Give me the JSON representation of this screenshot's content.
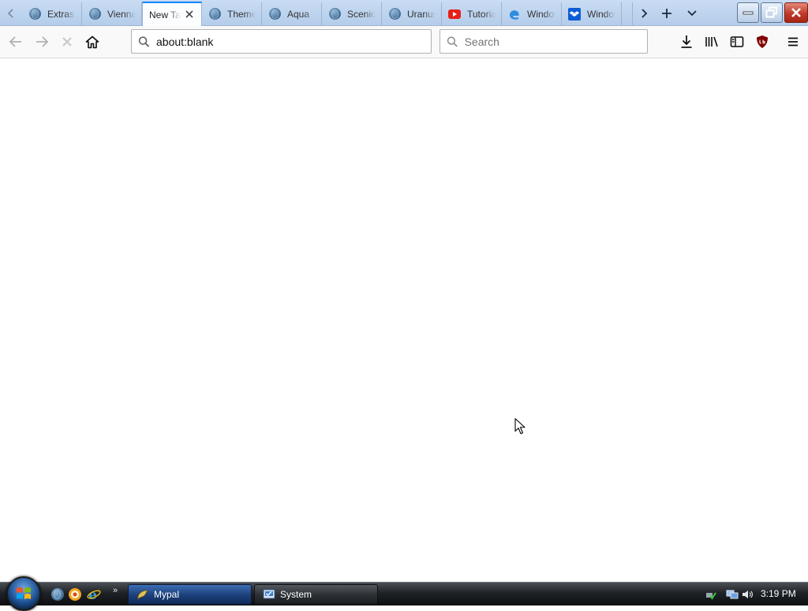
{
  "browser": {
    "tabs": [
      {
        "title": "Extras",
        "icon": "globe-icon",
        "active": false
      },
      {
        "title": "Vienna",
        "icon": "globe-icon",
        "active": false
      },
      {
        "title": "New Tab",
        "icon": "none",
        "active": true
      },
      {
        "title": "Themes",
        "icon": "globe-icon",
        "active": false
      },
      {
        "title": "Aqua",
        "icon": "globe-icon",
        "active": false
      },
      {
        "title": "Scenic",
        "icon": "globe-icon",
        "active": false
      },
      {
        "title": "Uranus",
        "icon": "globe-icon",
        "active": false
      },
      {
        "title": "Tutorial",
        "icon": "youtube-icon",
        "active": false
      },
      {
        "title": "Windows",
        "icon": "edge-icon",
        "active": false
      },
      {
        "title": "Windows",
        "icon": "dropbox-icon",
        "active": false
      }
    ],
    "url": "about:blank",
    "search_placeholder": "Search",
    "accent_color": "#0a84ff"
  },
  "taskbar": {
    "buttons": [
      {
        "label": "Mypal",
        "active": true
      },
      {
        "label": "System",
        "active": false
      }
    ],
    "clock": "3:19 PM"
  }
}
